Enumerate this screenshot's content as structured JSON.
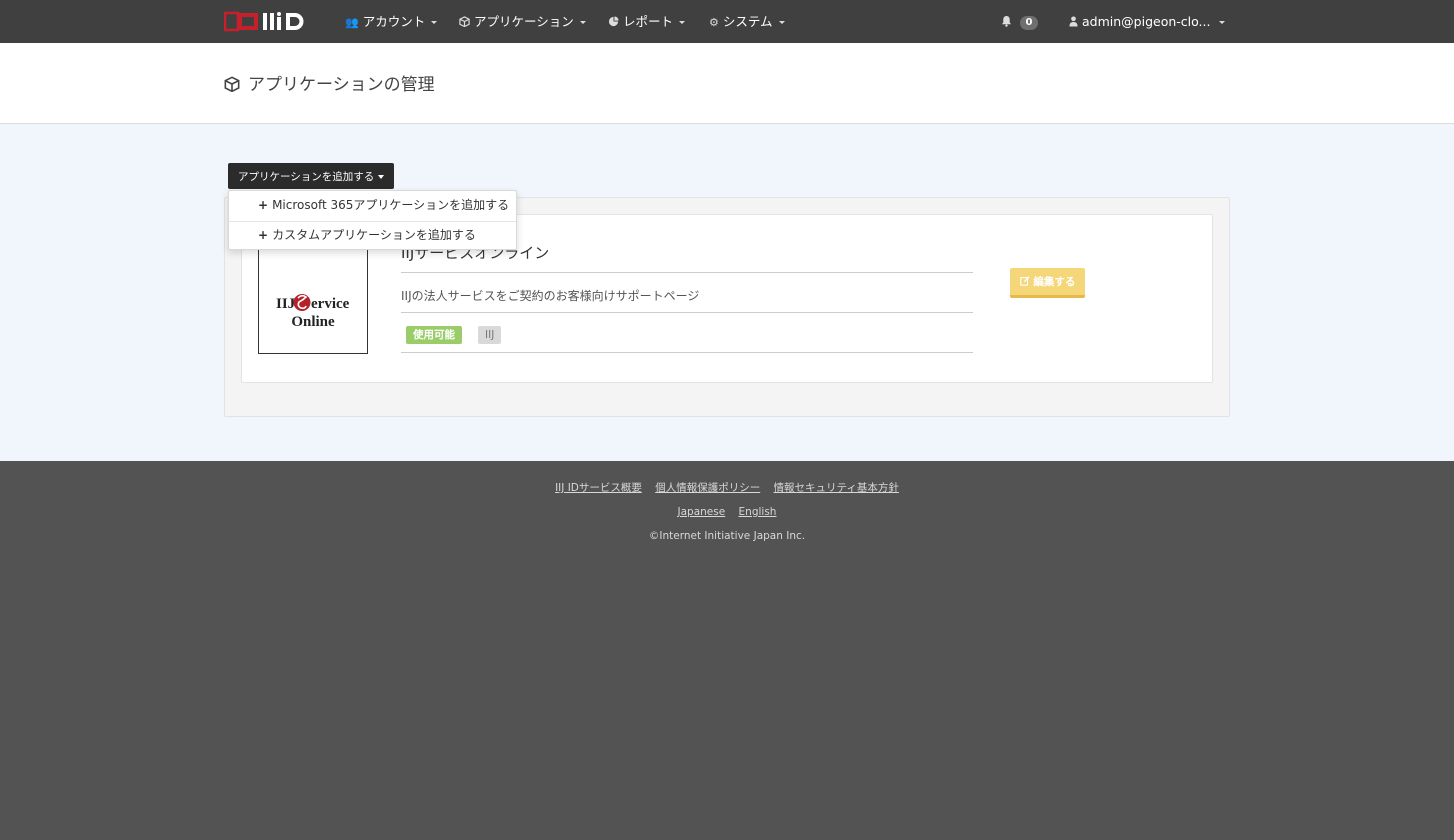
{
  "navbar": {
    "menu": [
      {
        "label": "アカウント",
        "icon": "users-icon"
      },
      {
        "label": "アプリケーション",
        "icon": "cube-icon"
      },
      {
        "label": "レポート",
        "icon": "pie-chart-icon"
      },
      {
        "label": "システム",
        "icon": "gear-icon"
      }
    ],
    "notification_count": "0",
    "user": "admin@pigeon-clo...",
    "colors": {
      "bar": "#404040",
      "logo_red": "#c8202a"
    }
  },
  "page": {
    "title": "アプリケーションの管理"
  },
  "toolbar": {
    "add_label": "アプリケーションを追加する"
  },
  "dropdown": {
    "items": [
      {
        "label": "Microsoft 365アプリケーションを追加する"
      },
      {
        "label": "カスタムアプリケーションを追加する"
      }
    ]
  },
  "app": {
    "name": "IIJサービスオンライン",
    "description": "IIJの法人サービスをご契約のお客様向けサポートページ",
    "logo_text_line1": "IIJ Service",
    "logo_text_line2": "Online",
    "tags": [
      "使用可能",
      "IIJ"
    ],
    "edit_label": "編集する",
    "colors": {
      "ok_tag": "#9acd6a",
      "edit_button": "#f5d77a"
    }
  },
  "footer": {
    "links": [
      "IIJ IDサービス概要",
      "個人情報保護ポリシー",
      "情報セキュリティ基本方針"
    ],
    "languages": [
      "Japanese",
      "English"
    ],
    "copyright": "©Internet Initiative Japan Inc."
  }
}
